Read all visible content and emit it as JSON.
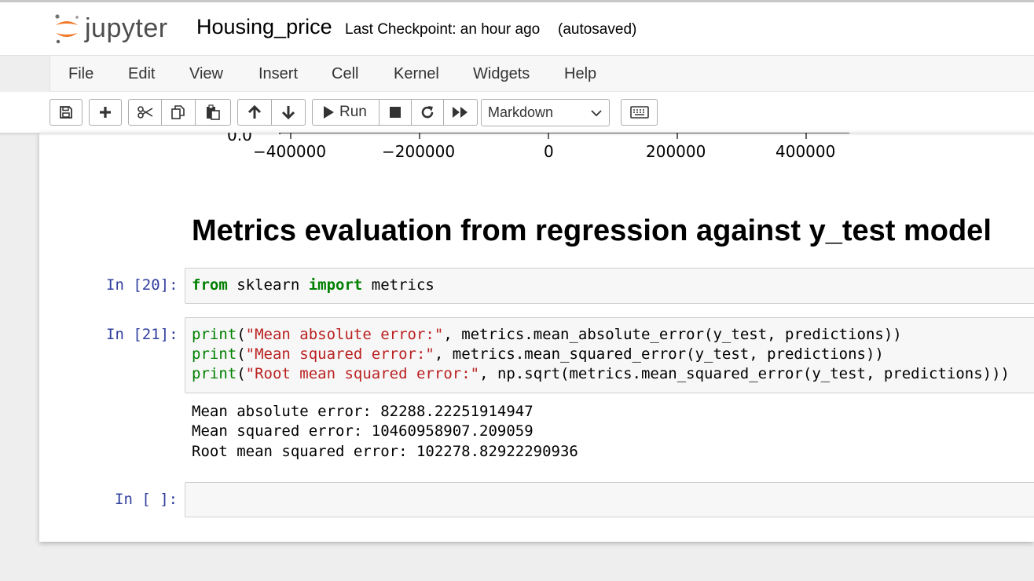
{
  "header": {
    "logo_text": "jupyter",
    "notebook_title": "Housing_price",
    "checkpoint": "Last Checkpoint: an hour ago",
    "autosave_status": "(autosaved)"
  },
  "menu": {
    "items": [
      "File",
      "Edit",
      "View",
      "Insert",
      "Cell",
      "Kernel",
      "Widgets",
      "Help"
    ]
  },
  "toolbar": {
    "run_label": "Run",
    "cell_type": "Markdown"
  },
  "plot": {
    "y_tick_partial": "0.0",
    "x_ticks": [
      "−400000",
      "−200000",
      "0",
      "200000",
      "400000"
    ]
  },
  "markdown": {
    "heading": "Metrics evaluation from regression against y_test model"
  },
  "cells": {
    "c20": {
      "prompt": "In [20]:",
      "tokens": [
        "from",
        " sklearn ",
        "import",
        " metrics"
      ]
    },
    "c21": {
      "prompt": "In [21]:",
      "line1": [
        "print",
        "(",
        "\"Mean absolute error:\"",
        ", metrics.mean_absolute_error(y_test, predictions))"
      ],
      "line2": [
        "print",
        "(",
        "\"Mean squared error:\"",
        ", metrics.mean_squared_error(y_test, predictions))"
      ],
      "line3": [
        "print",
        "(",
        "\"Root mean squared error:\"",
        ", np.sqrt(metrics.mean_squared_error(y_test, predictions)))"
      ],
      "outputs": [
        "Mean absolute error: 82288.22251914947",
        "Mean squared error: 10460958907.209059",
        "Root mean squared error: 102278.82922290936"
      ]
    },
    "empty": {
      "prompt": "In [ ]:"
    }
  },
  "colors": {
    "prompt": "#303f9f",
    "keyword": "#008000",
    "string": "#ba2121",
    "logo_orange": "#f37726"
  }
}
